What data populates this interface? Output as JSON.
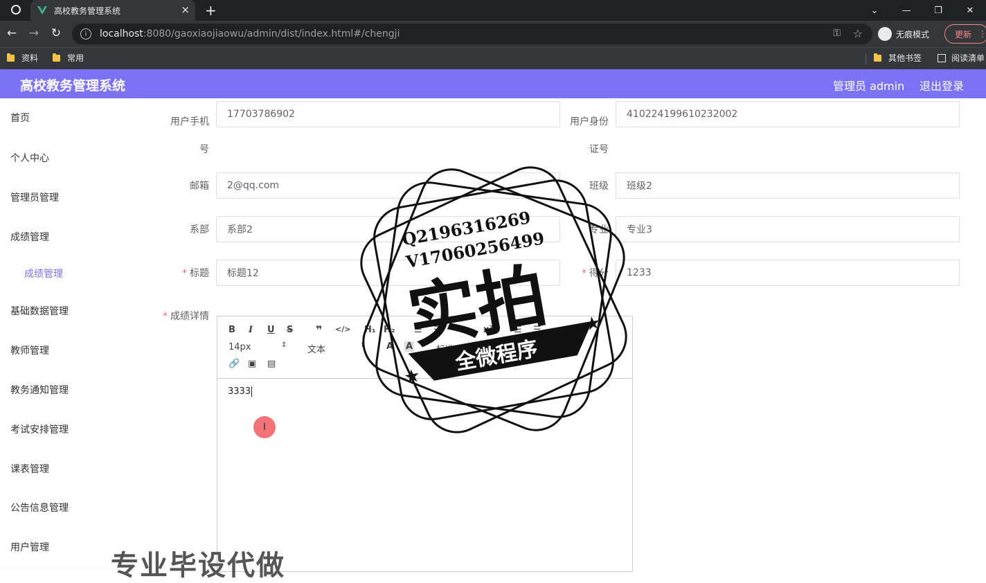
{
  "browser": {
    "tab_title": "高校教务管理系统",
    "tab_close": "×",
    "new_tab": "+",
    "url_host": "localhost",
    "url_rest": ":8080/gaoxiaojiaowu/admin/dist/index.html#/chengji",
    "incognito_label": "无痕模式",
    "update_label": "更新",
    "bookmarks": [
      "资料",
      "常用",
      "其他书签",
      "阅读清单"
    ]
  },
  "header": {
    "title": "高校教务管理系统",
    "user": "管理员 admin",
    "logout": "退出登录"
  },
  "sidebar": {
    "items": [
      "首页",
      "个人中心",
      "管理员管理",
      "成绩管理",
      "成绩管理",
      "基础数据管理",
      "教师管理",
      "教务通知管理",
      "考试安排管理",
      "课表管理",
      "公告信息管理",
      "用户管理"
    ]
  },
  "form": {
    "phone_label": "用户手机号",
    "phone_value": "17703786902",
    "idcard_label": "用户身份证号",
    "idcard_value": "410224199610232002",
    "email_label": "邮箱",
    "email_value": "2@qq.com",
    "class_label": "班级",
    "class_value": "班级2",
    "dept_label": "系部",
    "dept_value": "系部2",
    "major_label": "专业",
    "major_value": "专业3",
    "title_label": "标题",
    "title_value": "标题12",
    "score_label": "得分",
    "score_value": "1233",
    "detail_label": "成绩详情",
    "required_mark": "*"
  },
  "editor": {
    "font_size": "14px",
    "text_style": "文本",
    "font_family": "标准字体",
    "content": "3333"
  },
  "watermark": {
    "line1": "Q2196316269",
    "line2": "V17060256499",
    "big_text": "实拍",
    "banner": "全微程序",
    "bottom_text": "专业毕设代做"
  }
}
